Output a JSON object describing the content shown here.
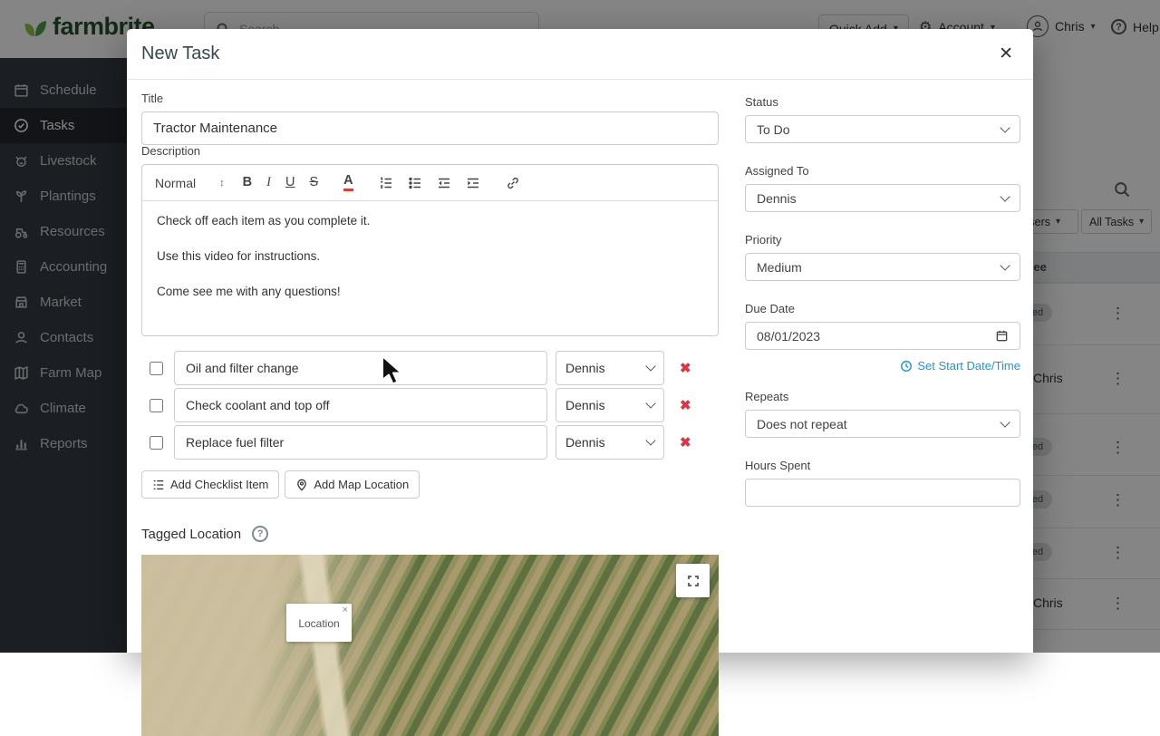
{
  "icons": {
    "close": "✕",
    "caret": "▾",
    "gear": "⚙",
    "kebab": "⋮",
    "delete": "✖",
    "updown": "↕",
    "question": "?",
    "bold": "B",
    "italic": "I",
    "underline": "U",
    "strike": "S",
    "color": "A",
    "tip_close": "×"
  },
  "colors": {
    "brand_green": "#3e9b4f",
    "link_blue": "#1a97d6",
    "danger_red": "#dc3545"
  },
  "topbar": {
    "logo_text": "farmbrite",
    "search_placeholder": "Search...",
    "quick_add_label": "Quick Add",
    "account_label": "Account",
    "user_name": "Chris",
    "help_label": "Help"
  },
  "sidebar": {
    "items": [
      {
        "label": "Schedule"
      },
      {
        "label": "Tasks"
      },
      {
        "label": "Livestock"
      },
      {
        "label": "Plantings"
      },
      {
        "label": "Resources"
      },
      {
        "label": "Accounting"
      },
      {
        "label": "Market"
      },
      {
        "label": "Contacts"
      },
      {
        "label": "Farm Map"
      },
      {
        "label": "Climate"
      },
      {
        "label": "Reports"
      }
    ]
  },
  "bg_table": {
    "filter_users": "All Users",
    "filter_tasks": "All Tasks",
    "header_assignee": "Assignee",
    "rows": [
      {
        "label": "Unassigned"
      },
      {
        "label": "Chris"
      },
      {
        "label": "Unassigned"
      },
      {
        "label": "Unassigned"
      },
      {
        "label": "Unassigned"
      },
      {
        "label": "Chris"
      }
    ]
  },
  "modal": {
    "title": "New Task",
    "fields": {
      "title": {
        "label": "Title",
        "value": "Tractor Maintenance"
      },
      "description": {
        "label": "Description",
        "style": "Normal",
        "lines": [
          "Check off each item as you complete it.",
          "Use this video for instructions.",
          "Come see me with any questions!"
        ]
      }
    },
    "checklist": {
      "items": [
        {
          "text": "Oil and filter change",
          "assignee": "Dennis"
        },
        {
          "text": "Check coolant and top off",
          "assignee": "Dennis"
        },
        {
          "text": "Replace fuel filter",
          "assignee": "Dennis"
        }
      ],
      "add_item_label": "Add Checklist Item",
      "add_map_label": "Add Map Location"
    },
    "tagged_location": {
      "label": "Tagged Location",
      "tooltip": "Location"
    },
    "details": {
      "status": {
        "label": "Status",
        "value": "To Do"
      },
      "assigned": {
        "label": "Assigned To",
        "value": "Dennis"
      },
      "priority": {
        "label": "Priority",
        "value": "Medium"
      },
      "due": {
        "label": "Due Date",
        "value": "08/01/2023"
      },
      "start_link": "Set Start Date/Time",
      "repeats": {
        "label": "Repeats",
        "value": "Does not repeat"
      },
      "hours": {
        "label": "Hours Spent",
        "value": ""
      }
    }
  }
}
